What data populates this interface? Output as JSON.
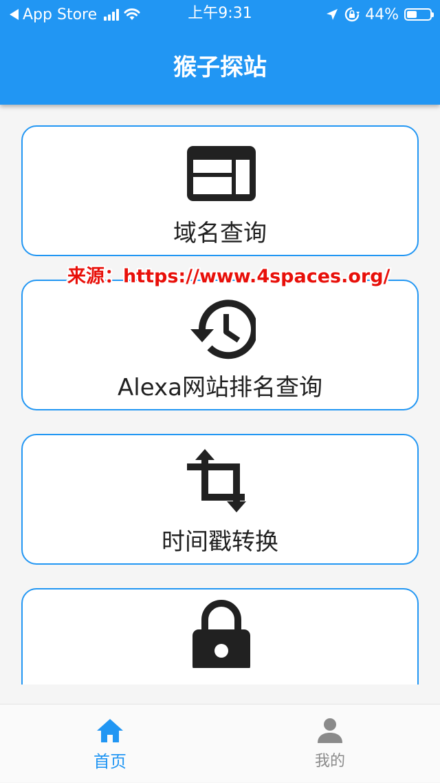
{
  "status_bar": {
    "back_label": "App Store",
    "time": "上午9:31",
    "battery_percent": "44%",
    "battery_level": 0.44,
    "icons": [
      "back-arrow-icon",
      "signal-icon",
      "wifi-icon",
      "location-icon",
      "orientation-lock-icon",
      "battery-icon"
    ]
  },
  "app_bar": {
    "title": "猴子探站"
  },
  "cards": [
    {
      "label": "域名查询",
      "icon": "web-layout-icon"
    },
    {
      "label": "Alexa网站排名查询",
      "icon": "history-icon"
    },
    {
      "label": "时间戳转换",
      "icon": "crop-rotate-icon"
    },
    {
      "label": "",
      "icon": "lock-icon"
    }
  ],
  "watermark": {
    "text": "来源：https://www.4spaces.org/"
  },
  "bottom_nav": {
    "items": [
      {
        "label": "首页",
        "icon": "home-icon",
        "active": true
      },
      {
        "label": "我的",
        "icon": "person-icon",
        "active": false
      }
    ]
  },
  "colors": {
    "primary": "#2196f3",
    "background": "#f5f5f5",
    "text": "#212121",
    "inactive": "#8a8a8a",
    "watermark": "#e8100a"
  }
}
